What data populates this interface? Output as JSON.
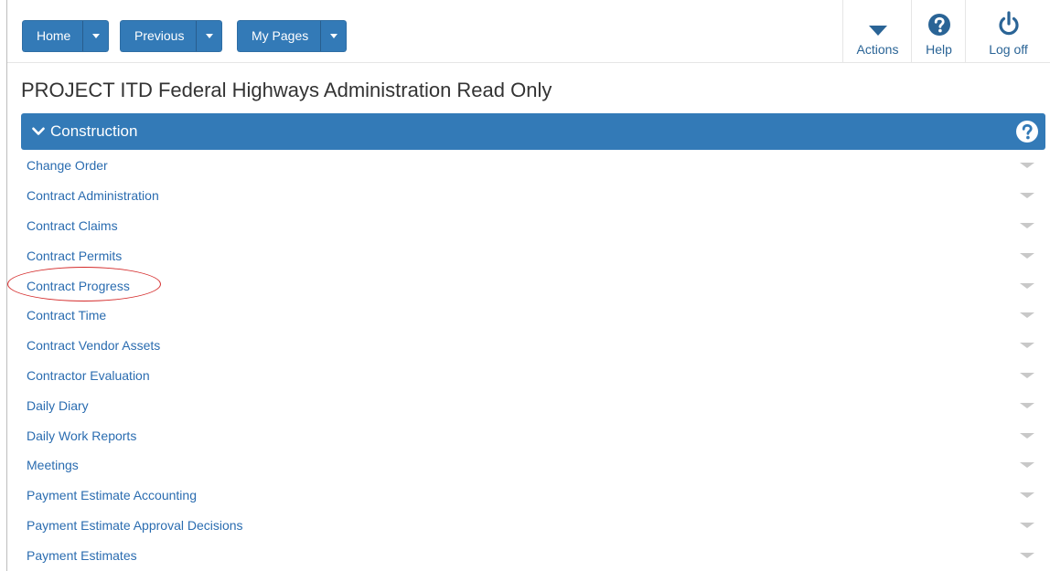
{
  "topbar": {
    "nav_buttons": [
      {
        "label": "Home"
      },
      {
        "label": "Previous"
      },
      {
        "label": "My Pages"
      }
    ],
    "tools": {
      "actions": "Actions",
      "help": "Help",
      "logoff": "Log off"
    }
  },
  "page": {
    "title": "PROJECT ITD Federal Highways Administration Read Only"
  },
  "section": {
    "title": "Construction",
    "items": [
      {
        "label": "Change Order"
      },
      {
        "label": "Contract Administration"
      },
      {
        "label": "Contract Claims"
      },
      {
        "label": "Contract Permits"
      },
      {
        "label": "Contract Progress"
      },
      {
        "label": "Contract Time"
      },
      {
        "label": "Contract Vendor Assets"
      },
      {
        "label": "Contractor Evaluation"
      },
      {
        "label": "Daily Diary"
      },
      {
        "label": "Daily Work Reports"
      },
      {
        "label": "Meetings"
      },
      {
        "label": "Payment Estimate Accounting"
      },
      {
        "label": "Payment Estimate Approval Decisions"
      },
      {
        "label": "Payment Estimates"
      }
    ]
  },
  "colors": {
    "primary": "#337ab7",
    "link": "#2a6cb0",
    "annotation": "#d42a2a"
  }
}
